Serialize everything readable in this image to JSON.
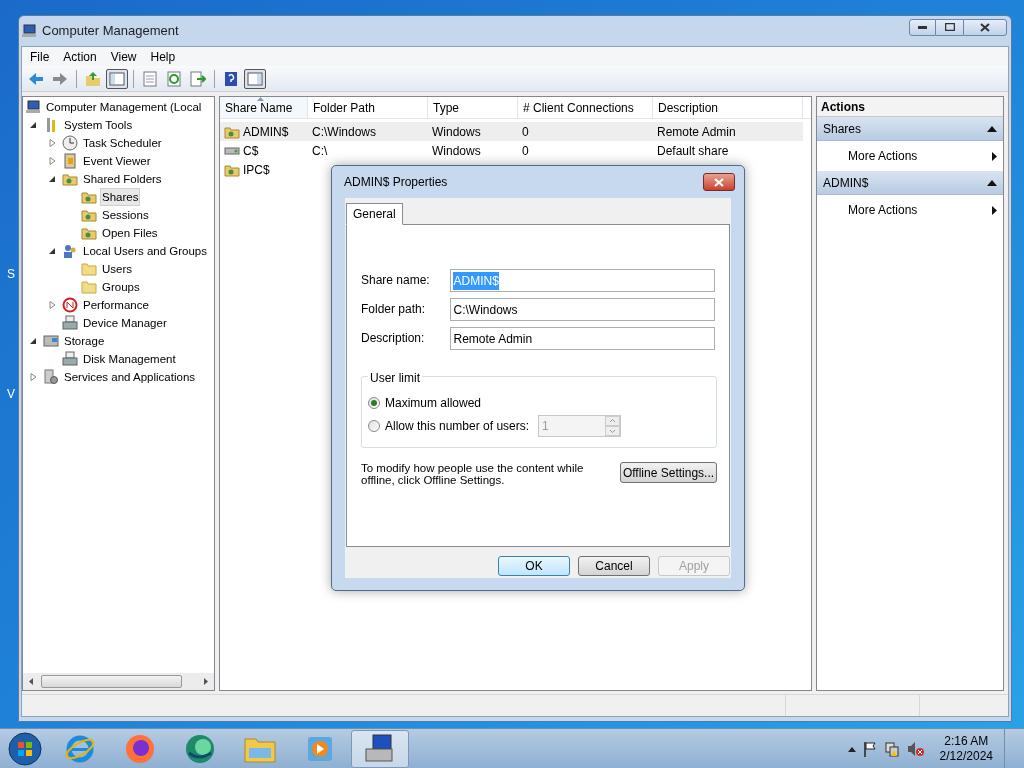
{
  "desktop_fragments": [
    "S",
    "V"
  ],
  "window": {
    "title": "Computer Management"
  },
  "menu": [
    "File",
    "Action",
    "View",
    "Help"
  ],
  "toolbar": [
    {
      "kind": "back",
      "pressed": false
    },
    {
      "kind": "forward",
      "pressed": false
    },
    {
      "kind": "sep"
    },
    {
      "kind": "up",
      "pressed": false
    },
    {
      "kind": "tree",
      "pressed": true
    },
    {
      "kind": "sep"
    },
    {
      "kind": "props",
      "pressed": false
    },
    {
      "kind": "refresh",
      "pressed": false
    },
    {
      "kind": "export",
      "pressed": false
    },
    {
      "kind": "sep"
    },
    {
      "kind": "help",
      "pressed": false
    },
    {
      "kind": "pane",
      "pressed": true
    }
  ],
  "tree": [
    {
      "label": "Computer Management (Local",
      "kind": "computer",
      "selected": false,
      "children": [
        {
          "label": "System Tools",
          "kind": "tools",
          "selected": false,
          "expanded": true,
          "children": [
            {
              "label": "Task Scheduler",
              "kind": "clock",
              "selected": false,
              "expanded": false
            },
            {
              "label": "Event Viewer",
              "kind": "log",
              "selected": false,
              "expanded": false
            },
            {
              "label": "Shared Folders",
              "kind": "share",
              "selected": false,
              "expanded": true,
              "children": [
                {
                  "label": "Shares",
                  "kind": "share",
                  "selected": true
                },
                {
                  "label": "Sessions",
                  "kind": "share",
                  "selected": false
                },
                {
                  "label": "Open Files",
                  "kind": "share",
                  "selected": false
                }
              ]
            },
            {
              "label": "Local Users and Groups",
              "kind": "users",
              "selected": false,
              "expanded": true,
              "children": [
                {
                  "label": "Users",
                  "kind": "folder",
                  "selected": false
                },
                {
                  "label": "Groups",
                  "kind": "folder",
                  "selected": false
                }
              ]
            },
            {
              "label": "Performance",
              "kind": "perf",
              "selected": false,
              "expanded": false
            },
            {
              "label": "Device Manager",
              "kind": "device",
              "selected": false
            }
          ]
        },
        {
          "label": "Storage",
          "kind": "storage",
          "selected": false,
          "expanded": true,
          "children": [
            {
              "label": "Disk Management",
              "kind": "device",
              "selected": false
            }
          ]
        },
        {
          "label": "Services and Applications",
          "kind": "services",
          "selected": false,
          "expanded": false
        }
      ]
    }
  ],
  "table": {
    "columns": [
      {
        "label": "Share Name",
        "sorted": true
      },
      {
        "label": "Folder Path",
        "sorted": false
      },
      {
        "label": "Type",
        "sorted": false
      },
      {
        "label": "# Client Connections",
        "sorted": false
      },
      {
        "label": "Description",
        "sorted": false
      }
    ],
    "rows": [
      {
        "kind": "share",
        "cells": [
          "ADMIN$",
          "C:\\Windows",
          "Windows",
          "0",
          "Remote Admin"
        ],
        "selected": true
      },
      {
        "kind": "drive",
        "cells": [
          "C$",
          "C:\\",
          "Windows",
          "0",
          "Default share"
        ],
        "selected": false
      },
      {
        "kind": "share",
        "cells": [
          "IPC$"
        ],
        "selected": false
      }
    ]
  },
  "actions": {
    "title": "Actions",
    "sections": [
      {
        "title": "Shares",
        "expanded": true,
        "items": [
          "More Actions"
        ]
      },
      {
        "title": "ADMIN$",
        "expanded": true,
        "items": [
          "More Actions"
        ]
      }
    ]
  },
  "dialog": {
    "title": "ADMIN$ Properties",
    "tabs": [
      {
        "label": "General",
        "selected": true
      }
    ],
    "fields": [
      {
        "label": "Share name:",
        "value": "ADMIN$",
        "highlighted": true
      },
      {
        "label": "Folder path:",
        "value": "C:\\Windows",
        "highlighted": false
      },
      {
        "label": "Description:",
        "value": "Remote Admin",
        "highlighted": false
      }
    ],
    "user_limit": {
      "title": "User limit",
      "options": [
        {
          "label": "Maximum allowed",
          "selected": true
        },
        {
          "label": "Allow this number of users:",
          "selected": false
        }
      ],
      "spinner": {
        "value": "1",
        "disabled": true
      }
    },
    "note": "To modify how people use the content while offline, click Offline Settings.",
    "offline_button": "Offline Settings...",
    "buttons": [
      {
        "label": "OK",
        "default": true,
        "disabled": false
      },
      {
        "label": "Cancel",
        "default": false,
        "disabled": false
      },
      {
        "label": "Apply",
        "default": false,
        "disabled": true
      }
    ]
  },
  "taskbar": {
    "apps": [
      {
        "kind": "ie",
        "active": false
      },
      {
        "kind": "firefox",
        "active": false
      },
      {
        "kind": "edge",
        "active": false
      },
      {
        "kind": "explorer",
        "active": false
      },
      {
        "kind": "media",
        "active": false
      },
      {
        "kind": "compmgmt",
        "active": true
      }
    ],
    "time": "2:16 AM",
    "date": "2/12/2024"
  }
}
